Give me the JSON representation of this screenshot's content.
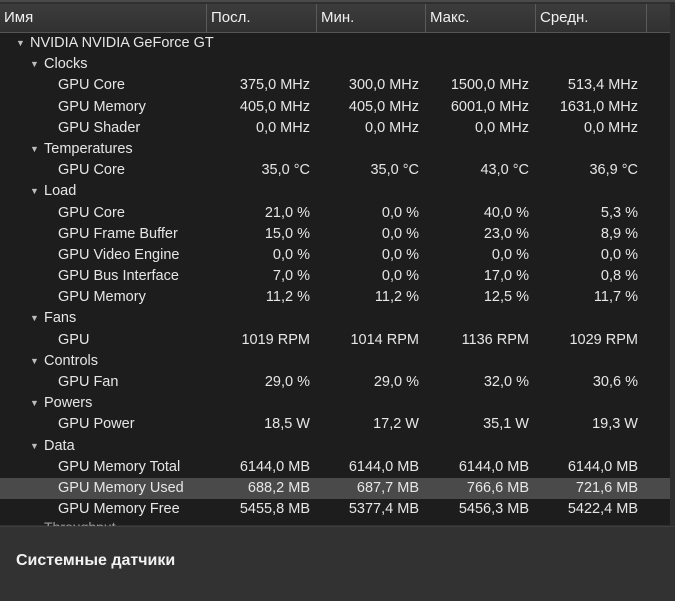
{
  "columns": [
    "Имя",
    "Посл.",
    "Мин.",
    "Макс.",
    "Средн."
  ],
  "rows": [
    {
      "level": 0,
      "label": "NVIDIA NVIDIA GeForce GT",
      "group": true
    },
    {
      "level": 1,
      "label": "Clocks",
      "group": true
    },
    {
      "level": 2,
      "label": "GPU Core",
      "values": [
        "375,0 MHz",
        "300,0 MHz",
        "1500,0 MHz",
        "513,4 MHz"
      ]
    },
    {
      "level": 2,
      "label": "GPU Memory",
      "values": [
        "405,0 MHz",
        "405,0 MHz",
        "6001,0 MHz",
        "1631,0 MHz"
      ]
    },
    {
      "level": 2,
      "label": "GPU Shader",
      "values": [
        "0,0 MHz",
        "0,0 MHz",
        "0,0 MHz",
        "0,0 MHz"
      ]
    },
    {
      "level": 1,
      "label": "Temperatures",
      "group": true
    },
    {
      "level": 2,
      "label": "GPU Core",
      "values": [
        "35,0 °C",
        "35,0 °C",
        "43,0 °C",
        "36,9 °C"
      ]
    },
    {
      "level": 1,
      "label": "Load",
      "group": true
    },
    {
      "level": 2,
      "label": "GPU Core",
      "values": [
        "21,0 %",
        "0,0 %",
        "40,0 %",
        "5,3 %"
      ]
    },
    {
      "level": 2,
      "label": "GPU Frame Buffer",
      "values": [
        "15,0 %",
        "0,0 %",
        "23,0 %",
        "8,9 %"
      ]
    },
    {
      "level": 2,
      "label": "GPU Video Engine",
      "values": [
        "0,0 %",
        "0,0 %",
        "0,0 %",
        "0,0 %"
      ]
    },
    {
      "level": 2,
      "label": "GPU Bus Interface",
      "values": [
        "7,0 %",
        "0,0 %",
        "17,0 %",
        "0,8 %"
      ]
    },
    {
      "level": 2,
      "label": "GPU Memory",
      "values": [
        "11,2 %",
        "11,2 %",
        "12,5 %",
        "11,7 %"
      ]
    },
    {
      "level": 1,
      "label": "Fans",
      "group": true
    },
    {
      "level": 2,
      "label": "GPU",
      "values": [
        "1019 RPM",
        "1014 RPM",
        "1136 RPM",
        "1029 RPM"
      ]
    },
    {
      "level": 1,
      "label": "Controls",
      "group": true
    },
    {
      "level": 2,
      "label": "GPU Fan",
      "values": [
        "29,0 %",
        "29,0 %",
        "32,0 %",
        "30,6 %"
      ]
    },
    {
      "level": 1,
      "label": "Powers",
      "group": true
    },
    {
      "level": 2,
      "label": "GPU Power",
      "values": [
        "18,5 W",
        "17,2 W",
        "35,1 W",
        "19,3 W"
      ]
    },
    {
      "level": 1,
      "label": "Data",
      "group": true
    },
    {
      "level": 2,
      "label": "GPU Memory Total",
      "values": [
        "6144,0 MB",
        "6144,0 MB",
        "6144,0 MB",
        "6144,0 MB"
      ]
    },
    {
      "level": 2,
      "label": "GPU Memory Used",
      "values": [
        "688,2 MB",
        "687,7 MB",
        "766,6 MB",
        "721,6 MB"
      ],
      "selected": true
    },
    {
      "level": 2,
      "label": "GPU Memory Free",
      "values": [
        "5455,8 MB",
        "5377,4 MB",
        "5456,3 MB",
        "5422,4 MB"
      ]
    }
  ],
  "cutoff_label": "Throughput",
  "footer_title": "Системные датчики"
}
